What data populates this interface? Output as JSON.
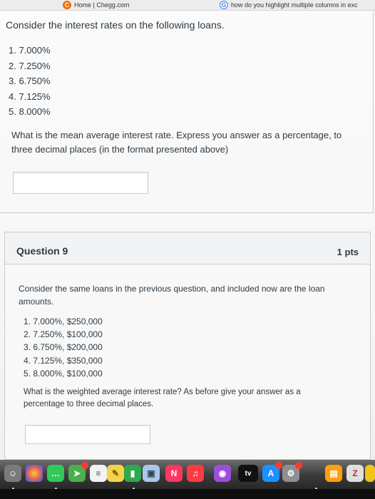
{
  "bookmarks": {
    "items": [
      {
        "icon": "chegg-icon",
        "label": "Home | Chegg.com"
      },
      {
        "icon": "google-icon",
        "label": "how do you highlight multiple columns in exc"
      }
    ]
  },
  "question8": {
    "prompt": "Consider the interest rates on the following loans.",
    "loans": [
      "1. 7.000%",
      "2. 7.250%",
      "3. 6.750%",
      "4. 7.125%",
      "5. 8.000%"
    ],
    "question": "What is the mean average interest rate.  Express you answer as a percentage, to three decimal places (in the format presented above)",
    "answer_value": ""
  },
  "question9": {
    "title": "Question 9",
    "points": "1 pts",
    "intro": "Consider the same loans in the previous question, and included now are the loan amounts.",
    "loans": [
      "1. 7.000%, $250,000",
      "2. 7.250%, $100,000",
      "3. 6.750%, $200,000",
      "4. 7.125%, $350,000",
      "5. 8.000%, $100,000"
    ],
    "question": "What is the weighted average interest rate? As before give your answer as a percentage to three decimal places.",
    "answer_value": ""
  },
  "dock": {
    "items": [
      {
        "name": "finder-icon",
        "color": "#7a7a7a"
      },
      {
        "name": "photos-icon",
        "color": "#e8a33b"
      },
      {
        "name": "messages-icon",
        "color": "#34c759"
      },
      {
        "name": "maps-icon",
        "color": "#4cae4f"
      },
      {
        "name": "reminders-icon",
        "color": "#f2f2f2"
      },
      {
        "name": "notes-icon",
        "color": "#f5d24a"
      },
      {
        "name": "numbers-icon",
        "color": "#2fa84f"
      },
      {
        "name": "preview-icon",
        "color": "#a9c7e8"
      },
      {
        "name": "news-icon",
        "color": "#ff375f"
      },
      {
        "name": "music-icon",
        "color": "#fc3c44"
      },
      {
        "name": "podcasts-icon",
        "color": "#9d4edd"
      },
      {
        "name": "tv-icon",
        "color": "#111111",
        "label": "tv"
      },
      {
        "name": "app-store-icon",
        "color": "#1e90ff"
      },
      {
        "name": "system-preferences-icon",
        "color": "#8e8e93"
      },
      {
        "name": "books-icon",
        "color": "#ff9f0a"
      },
      {
        "name": "zoom-icon",
        "color": "#e0e0e0"
      },
      {
        "name": "chrome-icon",
        "color": "#f0c419"
      }
    ]
  }
}
